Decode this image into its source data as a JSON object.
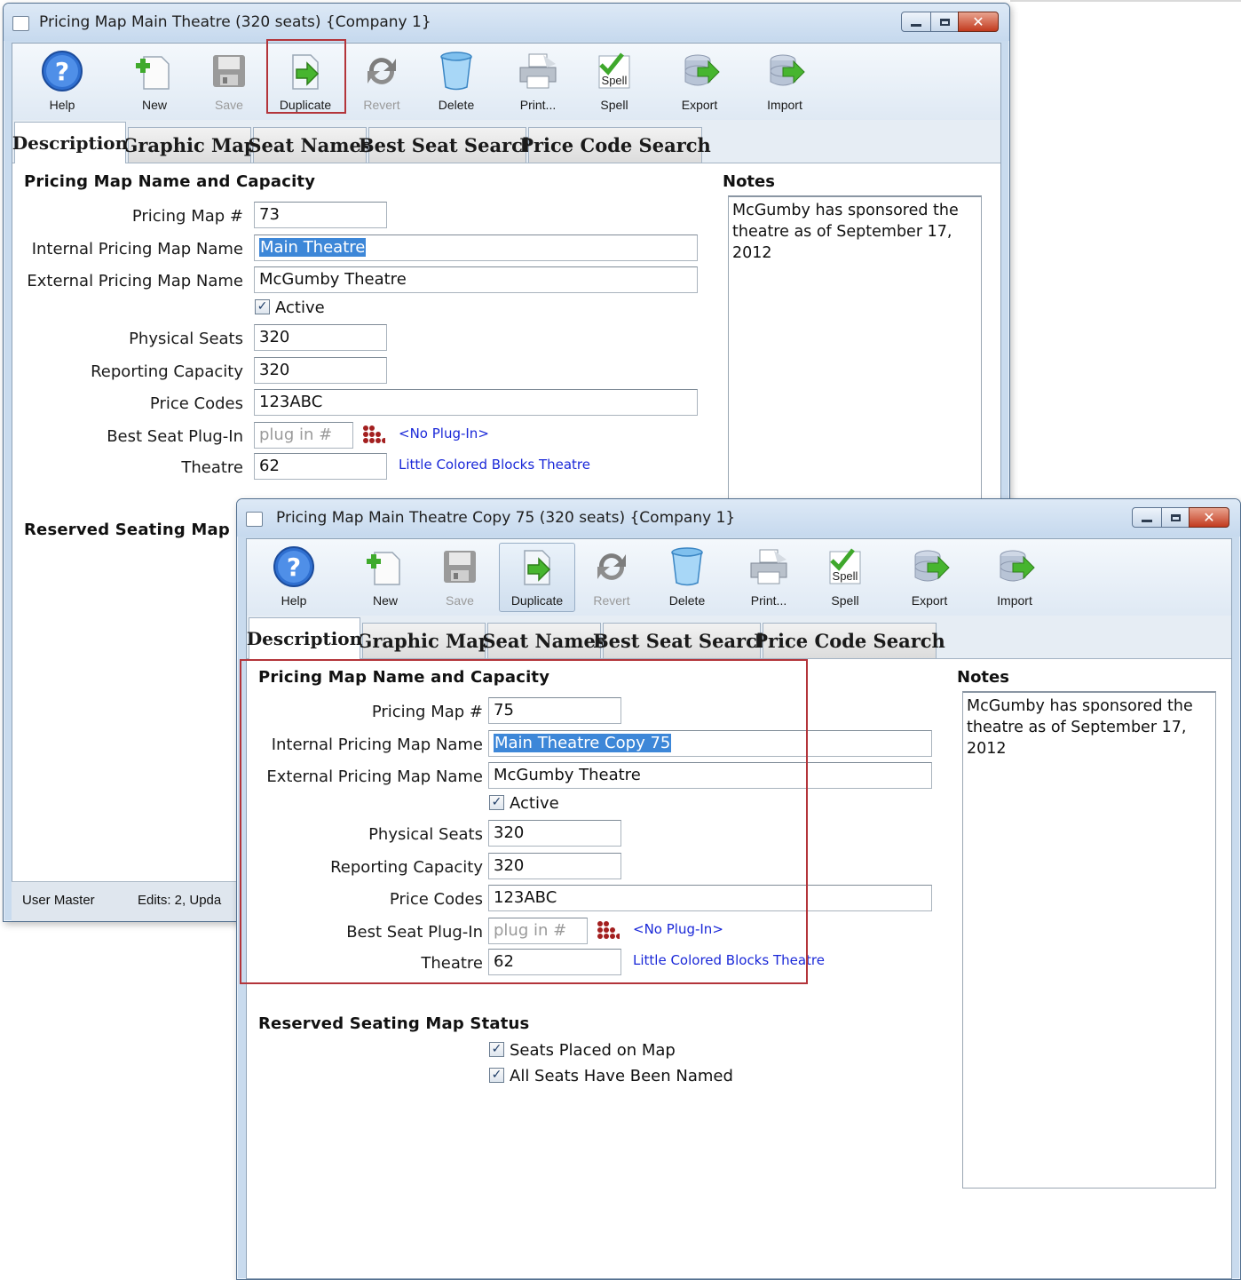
{
  "window1": {
    "title": "Pricing Map Main Theatre (320 seats) {Company 1}",
    "toolbar": {
      "help": "Help",
      "new": "New",
      "save": "Save",
      "duplicate": "Duplicate",
      "revert": "Revert",
      "delete": "Delete",
      "print": "Print...",
      "spell": "Spell",
      "export": "Export",
      "import": "Import",
      "spell_icon_text": "Spell"
    },
    "tabs": [
      "Description",
      "Graphic Map",
      "Seat Names",
      "Best Seat Search",
      "Price Code Search"
    ],
    "form": {
      "section_title": "Pricing Map Name and Capacity",
      "pricing_map_label": "Pricing Map #",
      "pricing_map_value": "73",
      "internal_name_label": "Internal Pricing Map Name",
      "internal_name_value": "Main Theatre",
      "external_name_label": "External Pricing Map Name",
      "external_name_value": "McGumby Theatre",
      "active_label": "Active",
      "physical_seats_label": "Physical Seats",
      "physical_seats_value": "320",
      "reporting_capacity_label": "Reporting Capacity",
      "reporting_capacity_value": "320",
      "price_codes_label": "Price Codes",
      "price_codes_value": "123ABC",
      "best_seat_label": "Best Seat Plug-In",
      "best_seat_placeholder": "plug in #",
      "best_seat_link": "<No Plug-In>",
      "theatre_label": "Theatre",
      "theatre_value": "62",
      "theatre_link": "Little Colored Blocks Theatre",
      "reserved_title": "Reserved Seating Map"
    },
    "notes": {
      "title": "Notes",
      "text": "McGumby has sponsored the\ntheatre as of September 17,\n2012"
    },
    "status": {
      "user": "User Master",
      "edits": "Edits: 2, Upda"
    }
  },
  "window2": {
    "title": "Pricing Map Main Theatre Copy 75 (320 seats) {Company 1}",
    "toolbar": {
      "help": "Help",
      "new": "New",
      "save": "Save",
      "duplicate": "Duplicate",
      "revert": "Revert",
      "delete": "Delete",
      "print": "Print...",
      "spell": "Spell",
      "export": "Export",
      "import": "Import",
      "spell_icon_text": "Spell"
    },
    "tabs": [
      "Description",
      "Graphic Map",
      "Seat Names",
      "Best Seat Search",
      "Price Code Search"
    ],
    "form": {
      "section_title": "Pricing Map Name and Capacity",
      "pricing_map_label": "Pricing Map #",
      "pricing_map_value": "75",
      "internal_name_label": "Internal Pricing Map Name",
      "internal_name_value": "Main Theatre Copy 75",
      "external_name_label": "External Pricing Map Name",
      "external_name_value": "McGumby Theatre",
      "active_label": "Active",
      "physical_seats_label": "Physical Seats",
      "physical_seats_value": "320",
      "reporting_capacity_label": "Reporting Capacity",
      "reporting_capacity_value": "320",
      "price_codes_label": "Price Codes",
      "price_codes_value": "123ABC",
      "best_seat_label": "Best Seat Plug-In",
      "best_seat_placeholder": "plug in #",
      "best_seat_link": "<No Plug-In>",
      "theatre_label": "Theatre",
      "theatre_value": "62",
      "theatre_link": "Little Colored Blocks Theatre",
      "reserved_title": "Reserved Seating Map Status",
      "seats_placed_label": "Seats Placed on Map",
      "seats_named_label": "All Seats Have Been Named"
    },
    "notes": {
      "title": "Notes",
      "text": "McGumby has sponsored the\ntheatre as of September 17,\n2012"
    }
  },
  "colors": {
    "highlight": "#b3343a",
    "link": "#1a28d8",
    "selection": "#3d87d8",
    "frame": "#c9dbee"
  }
}
